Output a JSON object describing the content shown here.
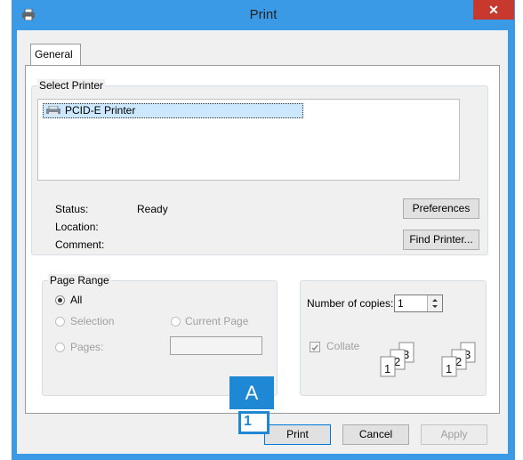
{
  "window": {
    "title": "Print",
    "close_label": "✕"
  },
  "tabs": [
    {
      "label": "General"
    }
  ],
  "select_printer": {
    "legend": "Select Printer",
    "printers": [
      {
        "name": "PCID-E Printer"
      }
    ],
    "status_label": "Status:",
    "status_value": "Ready",
    "location_label": "Location:",
    "location_value": "",
    "comment_label": "Comment:",
    "comment_value": "",
    "preferences_button": "Preferences",
    "find_printer_button": "Find Printer..."
  },
  "page_range": {
    "legend": "Page Range",
    "all_label": "All",
    "selection_label": "Selection",
    "current_page_label": "Current Page",
    "pages_label": "Pages:",
    "pages_value": ""
  },
  "copies": {
    "number_label": "Number of copies:",
    "number_value": "1",
    "collate_label": "Collate",
    "collate_checked": true
  },
  "buttons": {
    "print": "Print",
    "cancel": "Cancel",
    "apply": "Apply"
  },
  "annotations": {
    "letter": "A",
    "number": "1"
  },
  "colors": {
    "title_bar": "#3a9ae6",
    "close": "#c7392e",
    "annotation": "#1e88d4",
    "selected": "#cce8ff"
  }
}
